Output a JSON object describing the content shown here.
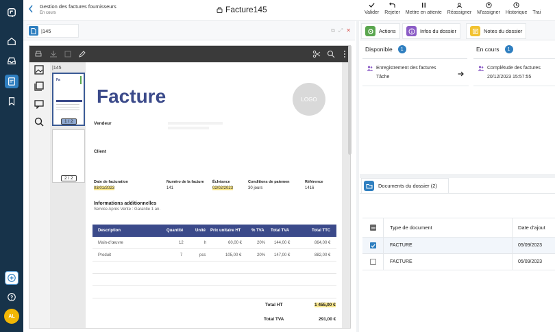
{
  "header": {
    "breadcrumb_title": "Gestion des factures fournisseurs",
    "breadcrumb_status": "En cours",
    "doc_title": "Facture145",
    "actions": [
      {
        "label": "Valider",
        "icon": "check-icon"
      },
      {
        "label": "Rejeter",
        "icon": "undo-icon"
      },
      {
        "label": "Mettre en attente",
        "icon": "pause-icon"
      },
      {
        "label": "Réassigner",
        "icon": "reassign-icon"
      },
      {
        "label": "M'assigner",
        "icon": "user-icon"
      },
      {
        "label": "Historique",
        "icon": "history-icon"
      },
      {
        "label": "Trai",
        "icon": "more-icon"
      }
    ]
  },
  "left_pane": {
    "tab_label": "|145",
    "thumb_label": "|145",
    "page_badges": [
      "1 / 2",
      "2 / 2"
    ]
  },
  "invoice": {
    "title": "Facture",
    "logo_text": "LOGO",
    "vendeur_label": "Vendeur",
    "client_label": "Client",
    "meta_headers": [
      "Date de facturation",
      "Numéro de la facture",
      "Échéance",
      "Conditions de paiemen",
      "Référence"
    ],
    "meta_values": [
      "03/01/2023",
      "141",
      "02/02/2023",
      "30 jours",
      "1416"
    ],
    "info_title": "Informations additionnelles",
    "info_text": "Service Après Vente : Garantie 1 an.",
    "table_headers": [
      "Description",
      "Quantité",
      "Unité",
      "Prix unitaire HT",
      "% TVA",
      "Total TVA",
      "Total TTC"
    ],
    "rows": [
      [
        "Main-d'œuvre",
        "12",
        "h",
        "60,00 €",
        "20%",
        "144,00 €",
        "864,00 €"
      ],
      [
        "Produit",
        "7",
        "pcs",
        "105,00 €",
        "20%",
        "147,00 €",
        "882,00 €"
      ]
    ],
    "total_ht_label": "Total HT",
    "total_ht_value": "1 455,00 €",
    "total_tva_label": "Total TVA",
    "total_tva_value": "291,00 €"
  },
  "right_pane": {
    "tabs": [
      {
        "label": "Actions",
        "color": "#5aa64f"
      },
      {
        "label": "Infos du dossier",
        "color": "#8b5cc6"
      },
      {
        "label": "Notes du dossier",
        "color": "#f2c230"
      }
    ],
    "disponible": {
      "title": "Disponible",
      "count": "1",
      "task_name": "Enregistrement des factures",
      "task_sub": "Tâche"
    },
    "en_cours": {
      "title": "En cours",
      "count": "1",
      "task_name": "Complétude des factures",
      "task_sub": "20/12/2023 15:57:55"
    },
    "documents": {
      "tab_label": "Documents du dossier (2)",
      "col_type": "Type de document",
      "col_date": "Date d'ajout",
      "rows": [
        {
          "type": "FACTURE",
          "date": "05/09/2023",
          "checked": true
        },
        {
          "type": "FACTURE",
          "date": "05/09/2023",
          "checked": false
        }
      ]
    }
  },
  "colors": {
    "nav_bg": "#17334a",
    "accent": "#2f7fc0",
    "invoice_blue": "#3b4a8a",
    "avatar": "#f2b705"
  },
  "avatar_initials": "AL"
}
